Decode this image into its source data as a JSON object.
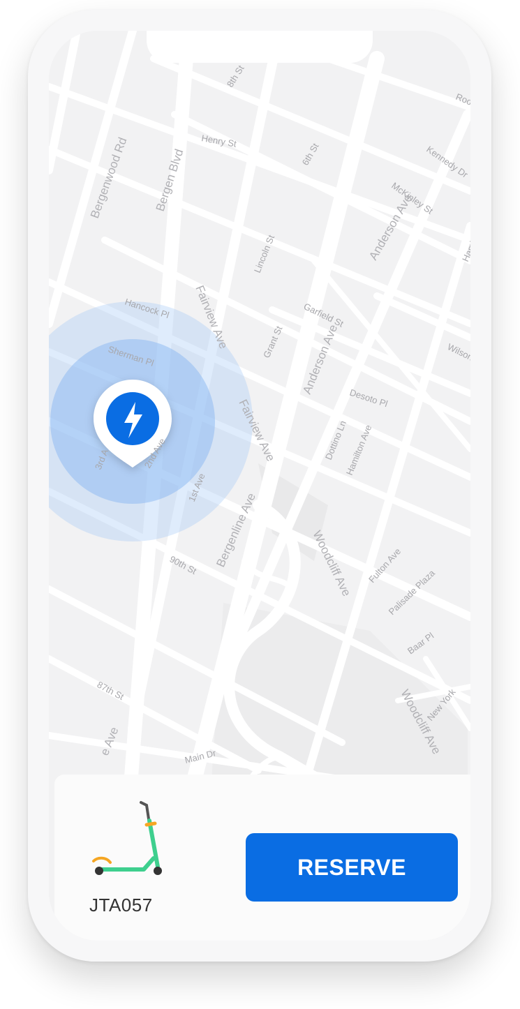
{
  "map": {
    "streets": [
      "8th St",
      "Henry St",
      "Roosev",
      "Kennedy Dr",
      "6th St",
      "McKinley St",
      "Bergenwood Rd",
      "Bergen Blvd",
      "Fairview Ave",
      "Lincoln St",
      "Anderson Ave",
      "Hamil",
      "Hancock Pl",
      "Garfield St",
      "Sherman Pl",
      "Grant St",
      "Wilson A",
      "Fairview Ave",
      "Anderson Ave",
      "Desoto Pl",
      "3rd A",
      "2nd Ave",
      "Dottino Ln",
      "Hamilton Ave",
      "1st Ave",
      "Woodcliff Ave",
      "Bergenline Ave",
      "90th St",
      "Fulton Ave",
      "Palisade Plaza",
      "Baar Pl",
      "87th St",
      "Woodcliff Ave",
      "New York",
      "e Ave",
      "Main Dr"
    ],
    "marker_icon": "lightning-bolt-icon",
    "marker_color": "#0a6de3",
    "radius_color": "#9cc3f5"
  },
  "vehicle": {
    "id": "JTA057",
    "icon": "scooter-icon"
  },
  "actions": {
    "reserve_label": "RESERVE"
  },
  "colors": {
    "accent": "#0a6de3",
    "scooter_body": "#3ecf8e",
    "scooter_accent": "#f5a623"
  }
}
